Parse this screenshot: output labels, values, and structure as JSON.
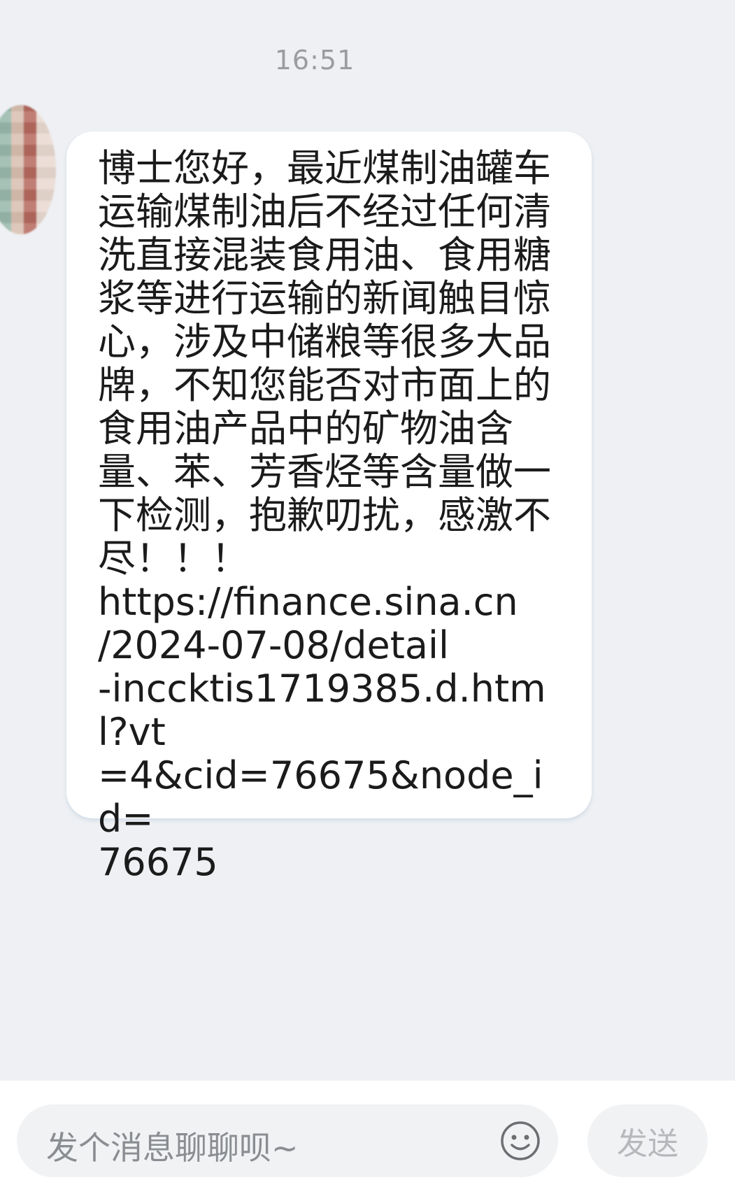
{
  "chat": {
    "timestamp": "16:51",
    "message": "博士您好，最近煤制油罐车\n运输煤制油后不经过任何清\n洗直接混装食用油、食用糖\n浆等进行运输的新闻触目惊\n心，涉及中储粮等很多大品\n牌，不知您能否对市面上的\n食用油产品中的矿物油含\n量、苯、芳香烃等含量做一\n下检测，抱歉叨扰，感激不\n尽！！！\nhttps://finance.sina.cn\n/2024-07-08/detail\n-inccktis1719385.d.html?vt\n=4&cid=76675&node_id=\n76675"
  },
  "composer": {
    "placeholder": "发个消息聊聊呗~",
    "send_label": "发送",
    "emoji_icon": "smiley-face-icon"
  },
  "colors": {
    "background": "#eef0f3",
    "bubble": "#ffffff",
    "text": "#1b1b1b",
    "placeholder": "#8a8d92",
    "send_disabled": "#b6b8bc"
  }
}
